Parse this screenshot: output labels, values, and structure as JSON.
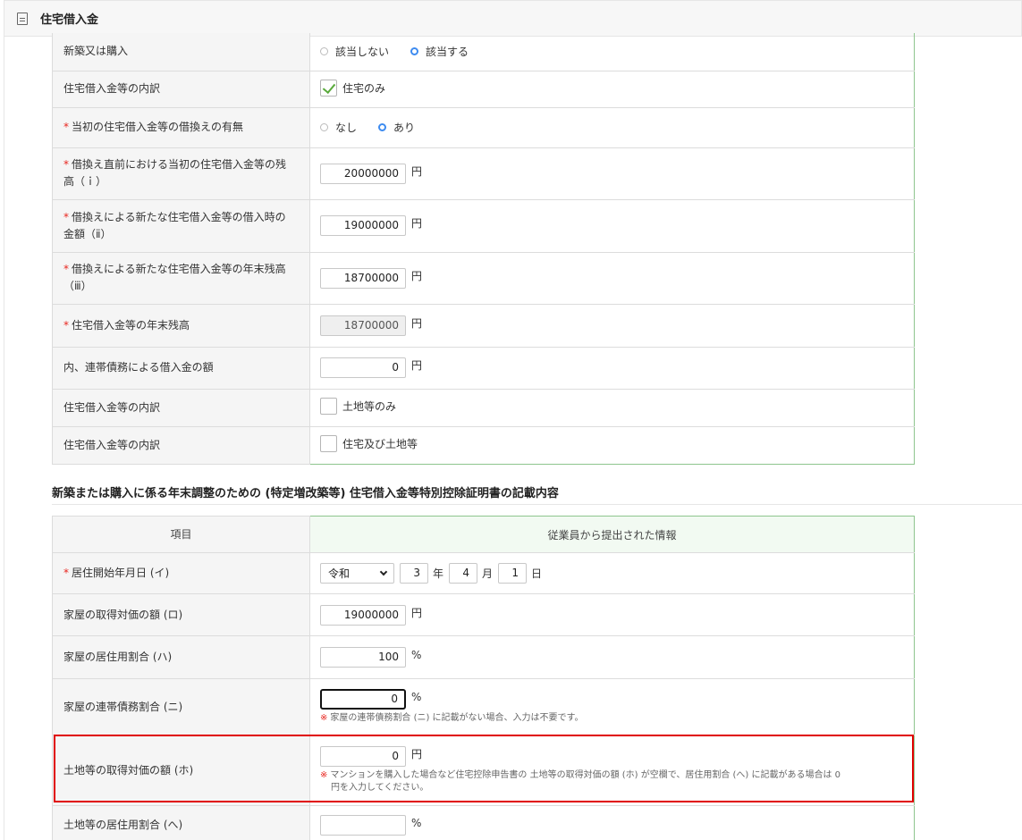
{
  "header": {
    "title": "住宅借入金",
    "icon": "document-icon"
  },
  "upper_rows": {
    "new_or_purchase": {
      "label": "新築又は購入",
      "options": [
        "該当しない",
        "該当する"
      ],
      "selected": "該当する"
    },
    "breakdown_house": {
      "label": "住宅借入金等の内訳",
      "checkbox_label": "住宅のみ",
      "checked": true
    },
    "refinance": {
      "label": "当初の住宅借入金等の借換えの有無",
      "required": "*",
      "options": [
        "なし",
        "あり"
      ],
      "selected": "あり"
    },
    "balance_before": {
      "label_line1": "借換え直前における当初の住宅借入金等の残",
      "label_line2": "高（ｉ）",
      "required": "*",
      "value": "20000000",
      "unit": "円"
    },
    "new_loan_amount": {
      "label_line1": "借換えによる新たな住宅借入金等の借入時の",
      "label_line2": "金額（ⅱ）",
      "required": "*",
      "value": "19000000",
      "unit": "円"
    },
    "new_loan_year_end": {
      "label_line1": "借換えによる新たな住宅借入金等の年末残高",
      "label_line2": "（ⅲ）",
      "required": "*",
      "value": "18700000",
      "unit": "円"
    },
    "year_end_balance": {
      "label": "住宅借入金等の年末残高",
      "required": "*",
      "value": "18700000",
      "unit": "円"
    },
    "joint_debt": {
      "label": "内、連帯債務による借入金の額",
      "value": "0",
      "unit": "円"
    },
    "breakdown_land": {
      "label": "住宅借入金等の内訳",
      "checkbox_label": "土地等のみ",
      "checked": false
    },
    "breakdown_both": {
      "label": "住宅借入金等の内訳",
      "checkbox_label": "住宅及び土地等",
      "checked": false
    }
  },
  "section": {
    "title": "新築または購入に係る年末調整のための (特定増改築等) 住宅借入金等特別控除証明書の記載内容",
    "col_item": "項目",
    "col_info": "従業員から提出された情報",
    "residence_start": {
      "label": "居住開始年月日 (イ)",
      "required": "*",
      "era": "令和",
      "year": "3",
      "year_unit": "年",
      "month": "4",
      "month_unit": "月",
      "day": "1",
      "day_unit": "日"
    },
    "house_cost": {
      "label": "家屋の取得対価の額 (ロ)",
      "value": "19000000",
      "unit": "円"
    },
    "house_residential_ratio": {
      "label": "家屋の居住用割合 (ハ)",
      "value": "100",
      "unit": "%"
    },
    "house_joint_ratio": {
      "label": "家屋の連帯債務割合 (ニ)",
      "value": "0",
      "unit": "%",
      "note_mark": "※",
      "note": "家屋の連帯債務割合 (ニ) に記載がない場合、入力は不要です。"
    },
    "land_cost": {
      "label": "土地等の取得対価の額 (ホ)",
      "value": "0",
      "unit": "円",
      "note_mark": "※",
      "note_line1": "マンションを購入した場合など住宅控除申告書の 土地等の取得対価の額 (ホ) が空欄で、居住用割合 (へ) に記載がある場合は 0",
      "note_line2": "円を入力してください。"
    },
    "land_residential_ratio": {
      "label": "土地等の居住用割合 (へ)",
      "value": "",
      "unit": "%"
    }
  },
  "colors": {
    "accent_green": "#8ec58e",
    "required_red": "#e8261f",
    "radio_blue": "#3d8bf0",
    "highlight_red": "#e00000"
  }
}
